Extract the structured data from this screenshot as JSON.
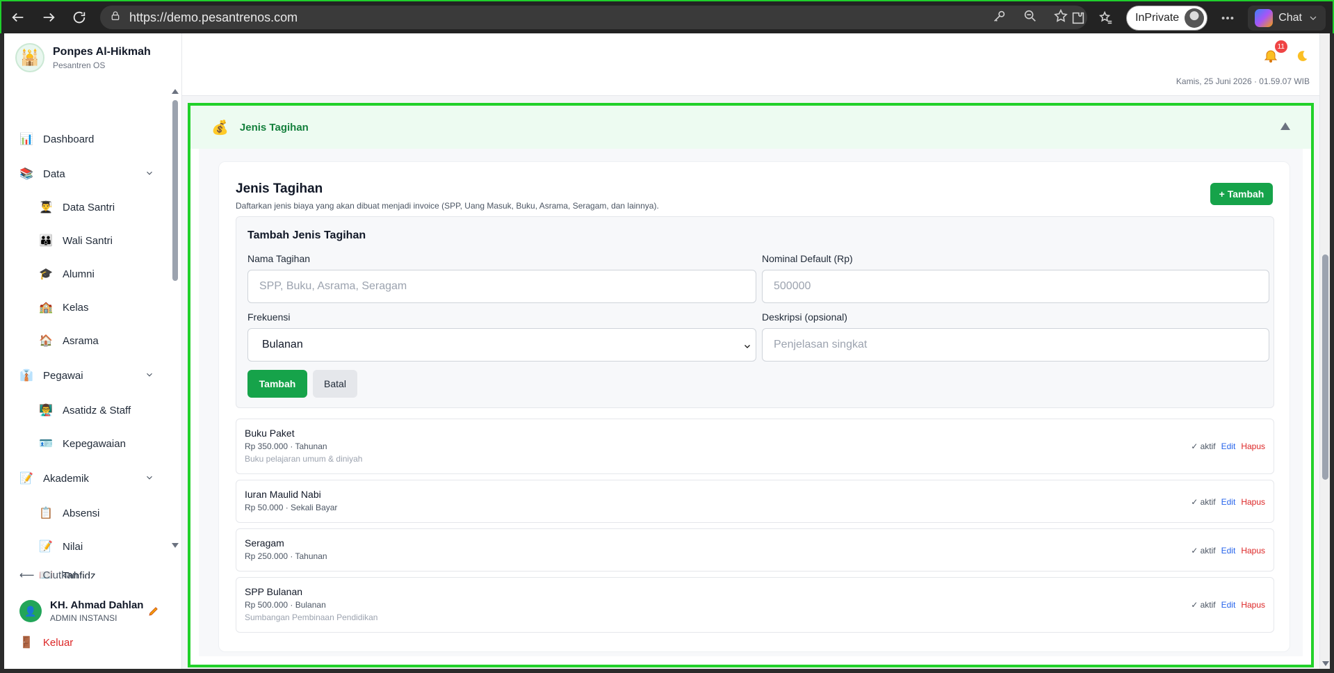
{
  "browser": {
    "url": "https://demo.pesantrenos.com",
    "inprivate_label": "InPrivate",
    "chat_label": "Chat"
  },
  "sidebar": {
    "brand_name": "Ponpes Al-Hikmah",
    "brand_sub": "Pesantren OS",
    "items": [
      {
        "label": "Dashboard",
        "icon": "📊"
      },
      {
        "label": "Data",
        "icon": "📚"
      },
      {
        "label": "Data Santri",
        "icon": "👨‍🎓"
      },
      {
        "label": "Wali Santri",
        "icon": "👪"
      },
      {
        "label": "Alumni",
        "icon": "🎓"
      },
      {
        "label": "Kelas",
        "icon": "🏫"
      },
      {
        "label": "Asrama",
        "icon": "🏠"
      },
      {
        "label": "Pegawai",
        "icon": "👔"
      },
      {
        "label": "Asatidz & Staff",
        "icon": "👨‍🏫"
      },
      {
        "label": "Kepegawaian",
        "icon": "🪪"
      },
      {
        "label": "Akademik",
        "icon": "📝"
      },
      {
        "label": "Absensi",
        "icon": "📋"
      },
      {
        "label": "Nilai",
        "icon": "📝"
      },
      {
        "label": "Tahfidz",
        "icon": "📖"
      }
    ],
    "collapse_label": "Ciutkan",
    "user_name": "KH. Ahmad Dahlan",
    "user_role": "ADMIN INSTANSI",
    "logout_label": "Keluar"
  },
  "header": {
    "notif_count": "11",
    "datetime": "Kamis, 25 Juni 2026 · 01.59.07 WIB"
  },
  "section": {
    "title": "Jenis Tagihan",
    "card_title": "Jenis Tagihan",
    "card_desc": "Daftarkan jenis biaya yang akan dibuat menjadi invoice (SPP, Uang Masuk, Buku, Asrama, Seragam, dan lainnya).",
    "add_label": "+ Tambah"
  },
  "form": {
    "title": "Tambah Jenis Tagihan",
    "name_label": "Nama Tagihan",
    "name_placeholder": "SPP, Buku, Asrama, Seragam",
    "nominal_label": "Nominal Default (Rp)",
    "nominal_placeholder": "500000",
    "freq_label": "Frekuensi",
    "freq_value": "Bulanan",
    "desc_label": "Deskripsi (opsional)",
    "desc_placeholder": "Penjelasan singkat",
    "submit_label": "Tambah",
    "cancel_label": "Batal"
  },
  "bills": [
    {
      "name": "Buku Paket",
      "meta": "Rp 350.000 · Tahunan",
      "desc": "Buku pelajaran umum & diniyah",
      "status": "✓ aktif",
      "edit": "Edit",
      "delete": "Hapus"
    },
    {
      "name": "Iuran Maulid Nabi",
      "meta": "Rp 50.000 · Sekali Bayar",
      "desc": "",
      "status": "✓ aktif",
      "edit": "Edit",
      "delete": "Hapus"
    },
    {
      "name": "Seragam",
      "meta": "Rp 250.000 · Tahunan",
      "desc": "",
      "status": "✓ aktif",
      "edit": "Edit",
      "delete": "Hapus"
    },
    {
      "name": "SPP Bulanan",
      "meta": "Rp 500.000 · Bulanan",
      "desc": "Sumbangan Pembinaan Pendidikan",
      "status": "✓ aktif",
      "edit": "Edit",
      "delete": "Hapus"
    }
  ]
}
